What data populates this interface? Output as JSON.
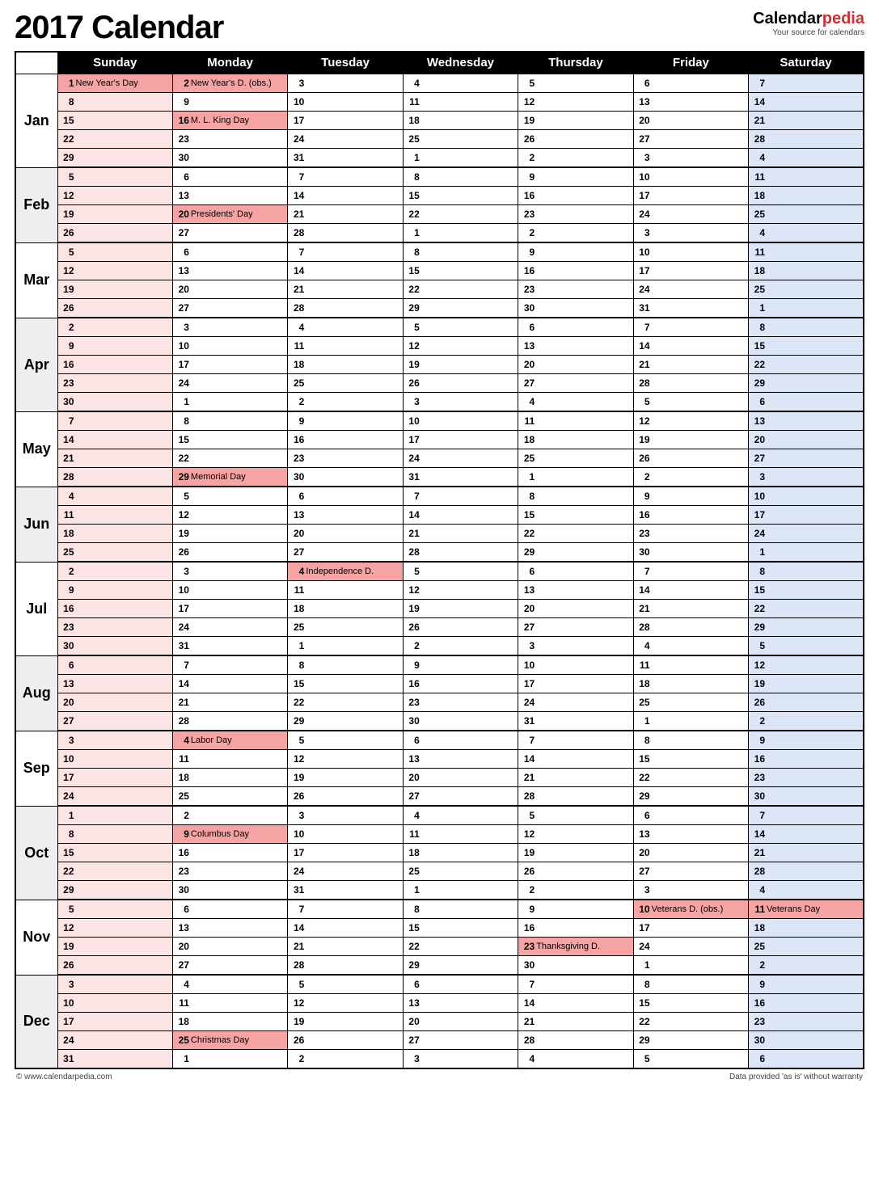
{
  "title": "2017 Calendar",
  "brand": {
    "name_a": "Calendar",
    "name_b": "pedia",
    "tagline": "Your source for calendars"
  },
  "footer": {
    "left": "© www.calendarpedia.com",
    "right": "Data provided 'as is' without warranty"
  },
  "dow": [
    "Sunday",
    "Monday",
    "Tuesday",
    "Wednesday",
    "Thursday",
    "Friday",
    "Saturday"
  ],
  "months": [
    {
      "label": "Jan",
      "shade": false,
      "weeks": [
        [
          {
            "n": 1,
            "t": "New Year's Day",
            "h": 1
          },
          {
            "n": 2,
            "t": "New Year's D. (obs.)",
            "h": 1
          },
          {
            "n": 3
          },
          {
            "n": 4
          },
          {
            "n": 5
          },
          {
            "n": 6
          },
          {
            "n": 7
          }
        ],
        [
          {
            "n": 8
          },
          {
            "n": 9
          },
          {
            "n": 10
          },
          {
            "n": 11
          },
          {
            "n": 12
          },
          {
            "n": 13
          },
          {
            "n": 14
          }
        ],
        [
          {
            "n": 15
          },
          {
            "n": 16,
            "t": "M. L. King Day",
            "h": 1
          },
          {
            "n": 17
          },
          {
            "n": 18
          },
          {
            "n": 19
          },
          {
            "n": 20
          },
          {
            "n": 21
          }
        ],
        [
          {
            "n": 22
          },
          {
            "n": 23
          },
          {
            "n": 24
          },
          {
            "n": 25
          },
          {
            "n": 26
          },
          {
            "n": 27
          },
          {
            "n": 28
          }
        ],
        [
          {
            "n": 29
          },
          {
            "n": 30
          },
          {
            "n": 31
          },
          {
            "n": 1
          },
          {
            "n": 2
          },
          {
            "n": 3
          },
          {
            "n": 4
          }
        ]
      ]
    },
    {
      "label": "Feb",
      "shade": true,
      "weeks": [
        [
          {
            "n": 5
          },
          {
            "n": 6
          },
          {
            "n": 7
          },
          {
            "n": 8
          },
          {
            "n": 9
          },
          {
            "n": 10
          },
          {
            "n": 11
          }
        ],
        [
          {
            "n": 12
          },
          {
            "n": 13
          },
          {
            "n": 14
          },
          {
            "n": 15
          },
          {
            "n": 16
          },
          {
            "n": 17
          },
          {
            "n": 18
          }
        ],
        [
          {
            "n": 19
          },
          {
            "n": 20,
            "t": "Presidents' Day",
            "h": 1
          },
          {
            "n": 21
          },
          {
            "n": 22
          },
          {
            "n": 23
          },
          {
            "n": 24
          },
          {
            "n": 25
          }
        ],
        [
          {
            "n": 26
          },
          {
            "n": 27
          },
          {
            "n": 28
          },
          {
            "n": 1
          },
          {
            "n": 2
          },
          {
            "n": 3
          },
          {
            "n": 4
          }
        ]
      ]
    },
    {
      "label": "Mar",
      "shade": false,
      "weeks": [
        [
          {
            "n": 5
          },
          {
            "n": 6
          },
          {
            "n": 7
          },
          {
            "n": 8
          },
          {
            "n": 9
          },
          {
            "n": 10
          },
          {
            "n": 11
          }
        ],
        [
          {
            "n": 12
          },
          {
            "n": 13
          },
          {
            "n": 14
          },
          {
            "n": 15
          },
          {
            "n": 16
          },
          {
            "n": 17
          },
          {
            "n": 18
          }
        ],
        [
          {
            "n": 19
          },
          {
            "n": 20
          },
          {
            "n": 21
          },
          {
            "n": 22
          },
          {
            "n": 23
          },
          {
            "n": 24
          },
          {
            "n": 25
          }
        ],
        [
          {
            "n": 26
          },
          {
            "n": 27
          },
          {
            "n": 28
          },
          {
            "n": 29
          },
          {
            "n": 30
          },
          {
            "n": 31
          },
          {
            "n": 1
          }
        ]
      ]
    },
    {
      "label": "Apr",
      "shade": true,
      "weeks": [
        [
          {
            "n": 2
          },
          {
            "n": 3
          },
          {
            "n": 4
          },
          {
            "n": 5
          },
          {
            "n": 6
          },
          {
            "n": 7
          },
          {
            "n": 8
          }
        ],
        [
          {
            "n": 9
          },
          {
            "n": 10
          },
          {
            "n": 11
          },
          {
            "n": 12
          },
          {
            "n": 13
          },
          {
            "n": 14
          },
          {
            "n": 15
          }
        ],
        [
          {
            "n": 16
          },
          {
            "n": 17
          },
          {
            "n": 18
          },
          {
            "n": 19
          },
          {
            "n": 20
          },
          {
            "n": 21
          },
          {
            "n": 22
          }
        ],
        [
          {
            "n": 23
          },
          {
            "n": 24
          },
          {
            "n": 25
          },
          {
            "n": 26
          },
          {
            "n": 27
          },
          {
            "n": 28
          },
          {
            "n": 29
          }
        ],
        [
          {
            "n": 30
          },
          {
            "n": 1
          },
          {
            "n": 2
          },
          {
            "n": 3
          },
          {
            "n": 4
          },
          {
            "n": 5
          },
          {
            "n": 6
          }
        ]
      ]
    },
    {
      "label": "May",
      "shade": false,
      "weeks": [
        [
          {
            "n": 7
          },
          {
            "n": 8
          },
          {
            "n": 9
          },
          {
            "n": 10
          },
          {
            "n": 11
          },
          {
            "n": 12
          },
          {
            "n": 13
          }
        ],
        [
          {
            "n": 14
          },
          {
            "n": 15
          },
          {
            "n": 16
          },
          {
            "n": 17
          },
          {
            "n": 18
          },
          {
            "n": 19
          },
          {
            "n": 20
          }
        ],
        [
          {
            "n": 21
          },
          {
            "n": 22
          },
          {
            "n": 23
          },
          {
            "n": 24
          },
          {
            "n": 25
          },
          {
            "n": 26
          },
          {
            "n": 27
          }
        ],
        [
          {
            "n": 28
          },
          {
            "n": 29,
            "t": "Memorial Day",
            "h": 1
          },
          {
            "n": 30
          },
          {
            "n": 31
          },
          {
            "n": 1
          },
          {
            "n": 2
          },
          {
            "n": 3
          }
        ]
      ]
    },
    {
      "label": "Jun",
      "shade": true,
      "weeks": [
        [
          {
            "n": 4
          },
          {
            "n": 5
          },
          {
            "n": 6
          },
          {
            "n": 7
          },
          {
            "n": 8
          },
          {
            "n": 9
          },
          {
            "n": 10
          }
        ],
        [
          {
            "n": 11
          },
          {
            "n": 12
          },
          {
            "n": 13
          },
          {
            "n": 14
          },
          {
            "n": 15
          },
          {
            "n": 16
          },
          {
            "n": 17
          }
        ],
        [
          {
            "n": 18
          },
          {
            "n": 19
          },
          {
            "n": 20
          },
          {
            "n": 21
          },
          {
            "n": 22
          },
          {
            "n": 23
          },
          {
            "n": 24
          }
        ],
        [
          {
            "n": 25
          },
          {
            "n": 26
          },
          {
            "n": 27
          },
          {
            "n": 28
          },
          {
            "n": 29
          },
          {
            "n": 30
          },
          {
            "n": 1
          }
        ]
      ]
    },
    {
      "label": "Jul",
      "shade": false,
      "weeks": [
        [
          {
            "n": 2
          },
          {
            "n": 3
          },
          {
            "n": 4,
            "t": "Independence D.",
            "h": 1
          },
          {
            "n": 5
          },
          {
            "n": 6
          },
          {
            "n": 7
          },
          {
            "n": 8
          }
        ],
        [
          {
            "n": 9
          },
          {
            "n": 10
          },
          {
            "n": 11
          },
          {
            "n": 12
          },
          {
            "n": 13
          },
          {
            "n": 14
          },
          {
            "n": 15
          }
        ],
        [
          {
            "n": 16
          },
          {
            "n": 17
          },
          {
            "n": 18
          },
          {
            "n": 19
          },
          {
            "n": 20
          },
          {
            "n": 21
          },
          {
            "n": 22
          }
        ],
        [
          {
            "n": 23
          },
          {
            "n": 24
          },
          {
            "n": 25
          },
          {
            "n": 26
          },
          {
            "n": 27
          },
          {
            "n": 28
          },
          {
            "n": 29
          }
        ],
        [
          {
            "n": 30
          },
          {
            "n": 31
          },
          {
            "n": 1
          },
          {
            "n": 2
          },
          {
            "n": 3
          },
          {
            "n": 4
          },
          {
            "n": 5
          }
        ]
      ]
    },
    {
      "label": "Aug",
      "shade": true,
      "weeks": [
        [
          {
            "n": 6
          },
          {
            "n": 7
          },
          {
            "n": 8
          },
          {
            "n": 9
          },
          {
            "n": 10
          },
          {
            "n": 11
          },
          {
            "n": 12
          }
        ],
        [
          {
            "n": 13
          },
          {
            "n": 14
          },
          {
            "n": 15
          },
          {
            "n": 16
          },
          {
            "n": 17
          },
          {
            "n": 18
          },
          {
            "n": 19
          }
        ],
        [
          {
            "n": 20
          },
          {
            "n": 21
          },
          {
            "n": 22
          },
          {
            "n": 23
          },
          {
            "n": 24
          },
          {
            "n": 25
          },
          {
            "n": 26
          }
        ],
        [
          {
            "n": 27
          },
          {
            "n": 28
          },
          {
            "n": 29
          },
          {
            "n": 30
          },
          {
            "n": 31
          },
          {
            "n": 1
          },
          {
            "n": 2
          }
        ]
      ]
    },
    {
      "label": "Sep",
      "shade": false,
      "weeks": [
        [
          {
            "n": 3
          },
          {
            "n": 4,
            "t": "Labor Day",
            "h": 1
          },
          {
            "n": 5
          },
          {
            "n": 6
          },
          {
            "n": 7
          },
          {
            "n": 8
          },
          {
            "n": 9
          }
        ],
        [
          {
            "n": 10
          },
          {
            "n": 11
          },
          {
            "n": 12
          },
          {
            "n": 13
          },
          {
            "n": 14
          },
          {
            "n": 15
          },
          {
            "n": 16
          }
        ],
        [
          {
            "n": 17
          },
          {
            "n": 18
          },
          {
            "n": 19
          },
          {
            "n": 20
          },
          {
            "n": 21
          },
          {
            "n": 22
          },
          {
            "n": 23
          }
        ],
        [
          {
            "n": 24
          },
          {
            "n": 25
          },
          {
            "n": 26
          },
          {
            "n": 27
          },
          {
            "n": 28
          },
          {
            "n": 29
          },
          {
            "n": 30
          }
        ]
      ]
    },
    {
      "label": "Oct",
      "shade": true,
      "weeks": [
        [
          {
            "n": 1
          },
          {
            "n": 2
          },
          {
            "n": 3
          },
          {
            "n": 4
          },
          {
            "n": 5
          },
          {
            "n": 6
          },
          {
            "n": 7
          }
        ],
        [
          {
            "n": 8
          },
          {
            "n": 9,
            "t": "Columbus Day",
            "h": 1
          },
          {
            "n": 10
          },
          {
            "n": 11
          },
          {
            "n": 12
          },
          {
            "n": 13
          },
          {
            "n": 14
          }
        ],
        [
          {
            "n": 15
          },
          {
            "n": 16
          },
          {
            "n": 17
          },
          {
            "n": 18
          },
          {
            "n": 19
          },
          {
            "n": 20
          },
          {
            "n": 21
          }
        ],
        [
          {
            "n": 22
          },
          {
            "n": 23
          },
          {
            "n": 24
          },
          {
            "n": 25
          },
          {
            "n": 26
          },
          {
            "n": 27
          },
          {
            "n": 28
          }
        ],
        [
          {
            "n": 29
          },
          {
            "n": 30
          },
          {
            "n": 31
          },
          {
            "n": 1
          },
          {
            "n": 2
          },
          {
            "n": 3
          },
          {
            "n": 4
          }
        ]
      ]
    },
    {
      "label": "Nov",
      "shade": false,
      "weeks": [
        [
          {
            "n": 5
          },
          {
            "n": 6
          },
          {
            "n": 7
          },
          {
            "n": 8
          },
          {
            "n": 9
          },
          {
            "n": 10,
            "t": "Veterans D. (obs.)",
            "h": 1
          },
          {
            "n": 11,
            "t": "Veterans Day",
            "h": 1
          }
        ],
        [
          {
            "n": 12
          },
          {
            "n": 13
          },
          {
            "n": 14
          },
          {
            "n": 15
          },
          {
            "n": 16
          },
          {
            "n": 17
          },
          {
            "n": 18
          }
        ],
        [
          {
            "n": 19
          },
          {
            "n": 20
          },
          {
            "n": 21
          },
          {
            "n": 22
          },
          {
            "n": 23,
            "t": "Thanksgiving D.",
            "h": 1
          },
          {
            "n": 24
          },
          {
            "n": 25
          }
        ],
        [
          {
            "n": 26
          },
          {
            "n": 27
          },
          {
            "n": 28
          },
          {
            "n": 29
          },
          {
            "n": 30
          },
          {
            "n": 1
          },
          {
            "n": 2
          }
        ]
      ]
    },
    {
      "label": "Dec",
      "shade": true,
      "weeks": [
        [
          {
            "n": 3
          },
          {
            "n": 4
          },
          {
            "n": 5
          },
          {
            "n": 6
          },
          {
            "n": 7
          },
          {
            "n": 8
          },
          {
            "n": 9
          }
        ],
        [
          {
            "n": 10
          },
          {
            "n": 11
          },
          {
            "n": 12
          },
          {
            "n": 13
          },
          {
            "n": 14
          },
          {
            "n": 15
          },
          {
            "n": 16
          }
        ],
        [
          {
            "n": 17
          },
          {
            "n": 18
          },
          {
            "n": 19
          },
          {
            "n": 20
          },
          {
            "n": 21
          },
          {
            "n": 22
          },
          {
            "n": 23
          }
        ],
        [
          {
            "n": 24
          },
          {
            "n": 25,
            "t": "Christmas Day",
            "h": 1
          },
          {
            "n": 26
          },
          {
            "n": 27
          },
          {
            "n": 28
          },
          {
            "n": 29
          },
          {
            "n": 30
          }
        ],
        [
          {
            "n": 31
          },
          {
            "n": 1
          },
          {
            "n": 2
          },
          {
            "n": 3
          },
          {
            "n": 4
          },
          {
            "n": 5
          },
          {
            "n": 6
          }
        ]
      ]
    }
  ]
}
